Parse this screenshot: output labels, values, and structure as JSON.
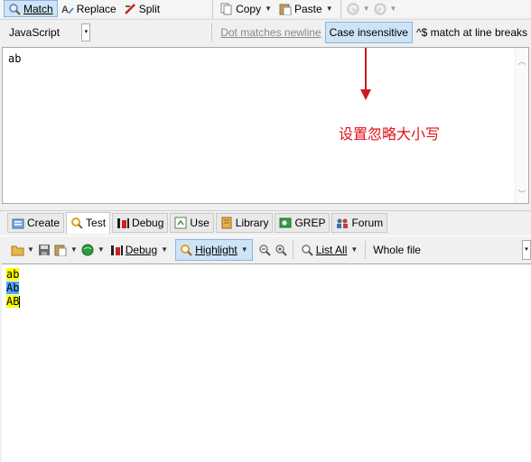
{
  "toolbar": {
    "match_label": "Match",
    "replace_label": "Replace",
    "split_label": "Split",
    "copy_label": "Copy",
    "paste_label": "Paste"
  },
  "options": {
    "flavor": "JavaScript",
    "dot_newline": "Dot matches newline",
    "case_insensitive": "Case insensitive",
    "line_breaks": "^$ match at line breaks"
  },
  "regex_text": "ab",
  "annotation": "设置忽略大小写",
  "tabs": [
    {
      "label": "Create",
      "icon": "create-icon"
    },
    {
      "label": "Test",
      "icon": "magnifier-icon",
      "active": true
    },
    {
      "label": "Debug",
      "icon": "debug-icon"
    },
    {
      "label": "Use",
      "icon": "use-icon"
    },
    {
      "label": "Library",
      "icon": "library-icon"
    },
    {
      "label": "GREP",
      "icon": "grep-icon"
    },
    {
      "label": "Forum",
      "icon": "forum-icon"
    }
  ],
  "test_toolbar": {
    "debug_label": "Debug",
    "highlight_label": "Highlight",
    "list_all_label": "List All",
    "scope_label": "Whole file"
  },
  "test_lines": [
    "ab",
    "Ab",
    "AB"
  ],
  "colors": {
    "match_yellow": "#ffff00",
    "match_blue": "#4ea6ff",
    "arrow_red": "#d0191d",
    "annotation_red": "#e0101a"
  }
}
